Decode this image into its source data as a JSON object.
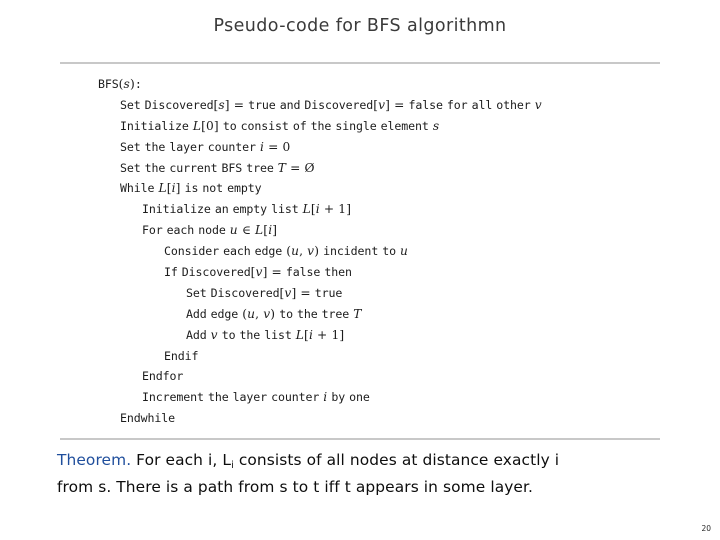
{
  "slide": {
    "title": "Pseudo-code for BFS algorithmn",
    "page_number": "20",
    "rule_color": "#c8c8c8",
    "accent_color": "#1f4e9c"
  },
  "code": {
    "lines": [
      {
        "indent": 0,
        "text": "BFS(s):"
      },
      {
        "indent": 1,
        "text": "Set Discovered[s] = true and Discovered[v] = false for all other v"
      },
      {
        "indent": 1,
        "text": "Initialize L[0] to consist of the single element s"
      },
      {
        "indent": 1,
        "text": "Set the layer counter i = 0"
      },
      {
        "indent": 1,
        "text": "Set the current BFS tree T = Ø"
      },
      {
        "indent": 1,
        "text": "While L[i] is not empty"
      },
      {
        "indent": 2,
        "text": "Initialize an empty list L[i + 1]"
      },
      {
        "indent": 2,
        "text": "For each node u ∈ L[i]"
      },
      {
        "indent": 3,
        "text": "Consider each edge (u, v) incident to u"
      },
      {
        "indent": 3,
        "text": "If Discovered[v] = false then"
      },
      {
        "indent": 4,
        "text": "Set Discovered[v] = true"
      },
      {
        "indent": 4,
        "text": "Add edge (u, v) to the tree T"
      },
      {
        "indent": 4,
        "text": "Add v to the list L[i + 1]"
      },
      {
        "indent": 3,
        "text": "Endif"
      },
      {
        "indent": 2,
        "text": "Endfor"
      },
      {
        "indent": 2,
        "text": "Increment the layer counter i by one"
      },
      {
        "indent": 1,
        "text": "Endwhile"
      }
    ]
  },
  "theorem": {
    "label": "Theorem.",
    "line1_before_sub": "  For each i, L",
    "sub": "i",
    "line1_after_sub": " consists of all nodes at distance exactly i",
    "line2": "from s.  There is a path from s to t iff t appears in some layer."
  }
}
